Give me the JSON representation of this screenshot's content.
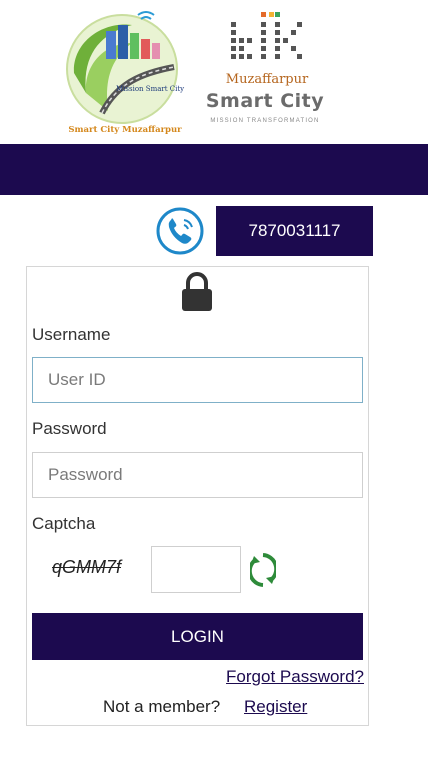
{
  "logos": {
    "left_banner_text": "Mission Smart City",
    "left_caption": "Smart City Muzaffarpur",
    "right_city": "Muzaffarpur",
    "right_title": "Smart City",
    "right_tagline": "MISSION TRANSFORMATION"
  },
  "contact": {
    "phone_number": "7870031117",
    "icon": "phone-icon"
  },
  "form": {
    "lock_icon": "lock-icon",
    "username_label": "Username",
    "username_placeholder": "User ID",
    "password_label": "Password",
    "password_placeholder": "Password",
    "captcha_label": "Captcha",
    "captcha_text": "qGMM7f",
    "login_label": "LOGIN",
    "forgot_label": "Forgot Password?",
    "not_member_label": "Not a member?",
    "register_label": "Register"
  },
  "colors": {
    "primary": "#1c0a4f",
    "phone_icon": "#1e88c9",
    "refresh_icon": "#2e8b3a",
    "input_focus_border": "#7fb0c8"
  }
}
